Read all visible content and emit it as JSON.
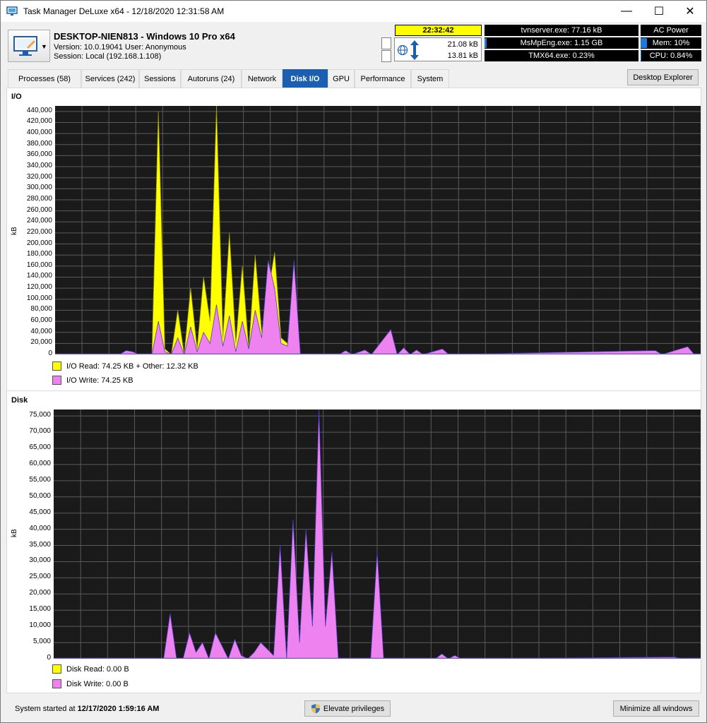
{
  "window": {
    "title": "Task Manager DeLuxe x64 - 12/18/2020 12:31:58 AM",
    "min_glyph": "—",
    "max_glyph": "☐",
    "close_glyph": "✕"
  },
  "host": {
    "name": "DESKTOP-NIEN813 - Windows 10 Pro x64",
    "version_line": "Version: 10.0.19041    User: Anonymous",
    "session_line": "Session: Local (192.168.1.108)",
    "dropdown_glyph": "▼"
  },
  "status": {
    "clock": "22:32:42",
    "net_down": "21.08 kB",
    "net_up": "13.81 kB",
    "proc1": "tvnserver.exe: 77.16 kB",
    "proc2": "MsMpEng.exe: 1.15 GB",
    "proc3": "TMX64.exe: 0.23%",
    "power": "AC Power",
    "mem": "Mem: 10%",
    "cpu": "CPU: 0.84%",
    "mem_fraction": 0.1,
    "cpu_fraction": 0.0084
  },
  "tabs": [
    "Processes (58)",
    "Services (242)",
    "Sessions",
    "Autoruns (24)",
    "Network",
    "Disk I/O",
    "GPU",
    "Performance",
    "System"
  ],
  "active_tab": "Disk I/O",
  "desktop_explorer_label": "Desktop Explorer",
  "io_panel": {
    "title": "I/O",
    "ylabel": "kB",
    "legend_read": "I/O Read: 74.25 KB + Other: 12.32 KB",
    "legend_write": "I/O Write: 74.25 KB",
    "read_color": "#ffff00",
    "write_color": "#ee82ee"
  },
  "disk_panel": {
    "title": "Disk",
    "ylabel": "kB",
    "legend_read": "Disk Read: 0.00 B",
    "legend_write": "Disk Write: 0.00 B",
    "read_color": "#ffff00",
    "write_color": "#ee82ee"
  },
  "footer": {
    "started_label": "System started at",
    "started_value": "12/17/2020 1:59:16 AM",
    "elevate_label": "Elevate privileges",
    "minimize_label": "Minimize all windows"
  },
  "chart_data": [
    {
      "type": "area",
      "title": "I/O",
      "ylabel": "kB",
      "ylim": [
        0,
        450000
      ],
      "y_ticks": [
        "0",
        "20,000",
        "40,000",
        "60,000",
        "80,000",
        "100,000",
        "120,000",
        "140,000",
        "160,000",
        "180,000",
        "200,000",
        "220,000",
        "240,000",
        "260,000",
        "280,000",
        "300,000",
        "320,000",
        "340,000",
        "360,000",
        "380,000",
        "400,000",
        "420,000",
        "440,000"
      ],
      "grid": true,
      "x_count": 100,
      "series": [
        {
          "name": "I/O Read: 74.25 KB + Other: 12.32 KB",
          "color": "#ffff00",
          "points": [
            [
              0,
              0
            ],
            [
              10,
              0
            ],
            [
              11,
              5000
            ],
            [
              12,
              3000
            ],
            [
              13,
              0
            ],
            [
              15,
              0
            ],
            [
              16,
              440000
            ],
            [
              17,
              10000
            ],
            [
              18,
              0
            ],
            [
              19,
              80000
            ],
            [
              20,
              0
            ],
            [
              21,
              120000
            ],
            [
              22,
              10000
            ],
            [
              23,
              140000
            ],
            [
              24,
              60000
            ],
            [
              25,
              450000
            ],
            [
              26,
              30000
            ],
            [
              27,
              220000
            ],
            [
              28,
              20000
            ],
            [
              29,
              160000
            ],
            [
              30,
              10000
            ],
            [
              31,
              180000
            ],
            [
              32,
              40000
            ],
            [
              33,
              110000
            ],
            [
              34,
              185000
            ],
            [
              35,
              30000
            ],
            [
              36,
              20000
            ],
            [
              37,
              150000
            ],
            [
              38,
              0
            ],
            [
              100,
              0
            ]
          ]
        },
        {
          "name": "I/O Write: 74.25 KB",
          "color": "#ee82ee",
          "points": [
            [
              0,
              0
            ],
            [
              10,
              0
            ],
            [
              11,
              7000
            ],
            [
              12,
              5000
            ],
            [
              13,
              0
            ],
            [
              15,
              0
            ],
            [
              16,
              60000
            ],
            [
              17,
              5000
            ],
            [
              18,
              0
            ],
            [
              19,
              30000
            ],
            [
              20,
              0
            ],
            [
              21,
              50000
            ],
            [
              22,
              5000
            ],
            [
              23,
              40000
            ],
            [
              24,
              20000
            ],
            [
              25,
              90000
            ],
            [
              26,
              15000
            ],
            [
              27,
              70000
            ],
            [
              28,
              5000
            ],
            [
              29,
              60000
            ],
            [
              30,
              10000
            ],
            [
              31,
              80000
            ],
            [
              32,
              30000
            ],
            [
              33,
              170000
            ],
            [
              34,
              120000
            ],
            [
              35,
              20000
            ],
            [
              36,
              15000
            ],
            [
              37,
              170000
            ],
            [
              38,
              0
            ],
            [
              44,
              0
            ],
            [
              45,
              7000
            ],
            [
              46,
              0
            ],
            [
              48,
              8000
            ],
            [
              49,
              0
            ],
            [
              52,
              45000
            ],
            [
              53,
              0
            ],
            [
              54,
              12000
            ],
            [
              55,
              0
            ],
            [
              56,
              8000
            ],
            [
              57,
              0
            ],
            [
              60,
              10000
            ],
            [
              61,
              0
            ],
            [
              93,
              7000
            ],
            [
              94,
              0
            ],
            [
              98,
              14000
            ],
            [
              99,
              0
            ],
            [
              100,
              0
            ]
          ]
        }
      ]
    },
    {
      "type": "area",
      "title": "Disk",
      "ylabel": "kB",
      "ylim": [
        0,
        77000
      ],
      "y_ticks": [
        "0",
        "5,000",
        "10,000",
        "15,000",
        "20,000",
        "25,000",
        "30,000",
        "35,000",
        "40,000",
        "45,000",
        "50,000",
        "55,000",
        "60,000",
        "65,000",
        "70,000",
        "75,000"
      ],
      "grid": true,
      "x_count": 100,
      "series": [
        {
          "name": "Disk Read: 0.00 B",
          "color": "#ffff00",
          "points": [
            [
              0,
              0
            ],
            [
              100,
              0
            ]
          ]
        },
        {
          "name": "Disk Write: 0.00 B",
          "color": "#ee82ee",
          "points": [
            [
              0,
              0
            ],
            [
              17,
              0
            ],
            [
              18,
              14000
            ],
            [
              19,
              0
            ],
            [
              20,
              0
            ],
            [
              21,
              8000
            ],
            [
              22,
              2000
            ],
            [
              23,
              5000
            ],
            [
              24,
              0
            ],
            [
              25,
              8000
            ],
            [
              26,
              4000
            ],
            [
              27,
              0
            ],
            [
              28,
              6000
            ],
            [
              29,
              1000
            ],
            [
              30,
              0
            ],
            [
              31,
              2000
            ],
            [
              32,
              5000
            ],
            [
              33,
              3000
            ],
            [
              34,
              1000
            ],
            [
              35,
              35000
            ],
            [
              36,
              0
            ],
            [
              37,
              43000
            ],
            [
              38,
              5000
            ],
            [
              39,
              40000
            ],
            [
              40,
              10000
            ],
            [
              41,
              77000
            ],
            [
              42,
              10000
            ],
            [
              43,
              33000
            ],
            [
              44,
              0
            ],
            [
              49,
              0
            ],
            [
              50,
              33000
            ],
            [
              51,
              0
            ],
            [
              59,
              0
            ],
            [
              60,
              1500
            ],
            [
              61,
              0
            ],
            [
              62,
              1000
            ],
            [
              63,
              0
            ],
            [
              96,
              500
            ],
            [
              97,
              0
            ],
            [
              100,
              0
            ]
          ]
        }
      ]
    }
  ]
}
